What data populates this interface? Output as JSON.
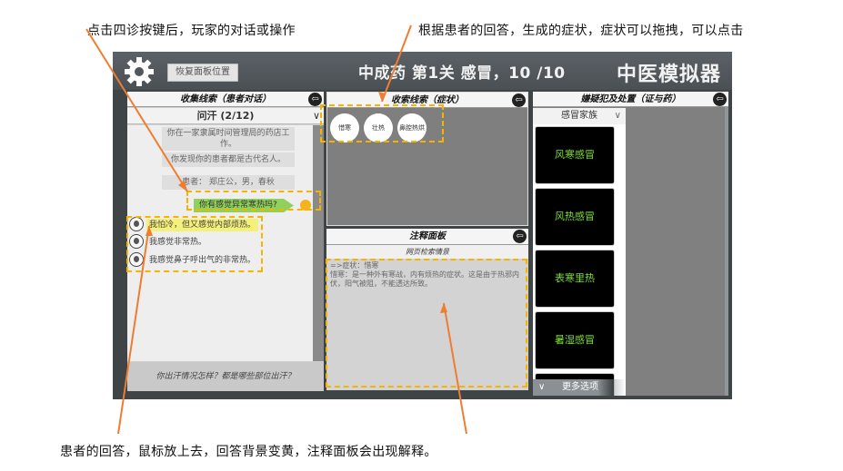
{
  "annotations": {
    "top_left": "点击四诊按键后，玩家的对话或操作",
    "top_right": "根据患者的回答，生成的症状，症状可以拖拽，可以点击",
    "bottom": "患者的回答，鼠标放上去，回答背景变黄，注释面板会出现解释。"
  },
  "header": {
    "settings_icon": "gear-icon",
    "restore_button": "恢复面板位置",
    "level_title": "中成药 第1关 感冒，10 /10",
    "app_title": "中医模拟器"
  },
  "clue_panel": {
    "title": "收集线索（患者对话）",
    "back_icon": "back-arrow-icon",
    "dropdown_value": "问汗 (2/12)",
    "system_messages": [
      "你在一家隶属时间管理局的药店工作。",
      "你发现你的患者都是古代名人。",
      "患者：  郑庄公，男，春秋"
    ],
    "player_message": "你有感觉异常寒热吗?",
    "patient_replies": [
      {
        "text": "我怕冷，但又感觉内部烦热。",
        "highlighted": true
      },
      {
        "text": "我感觉非常热。",
        "highlighted": false
      },
      {
        "text": "我感觉鼻子呼出气的非常热。",
        "highlighted": false
      }
    ],
    "question_prompt": "你出汗情况怎样？都是哪些部位出汗？"
  },
  "symptom_panel": {
    "title": "收索线索（症状）",
    "symptoms": [
      "惜寒",
      "壮热",
      "鼻腔热烘"
    ]
  },
  "note_panel": {
    "title": "注释面板",
    "subtitle": "网页检索情景",
    "line1": "=>症状：惜寒",
    "line2": "惜寒：是一种外有寒战，内有烦热的症状。这是由于热邪内伏，阳气被阻，不能透达所致。"
  },
  "diagnosis_panel": {
    "title": "嫌疑犯及处置（证与药）",
    "family_select": "感冒家族",
    "cards": [
      "风寒感冒",
      "风热感冒",
      "表寒里热",
      "暑湿感冒"
    ],
    "more_options": "更多选项"
  },
  "colors": {
    "highlight_dash": "#f4b400",
    "annotation_arrow": "#ee7d31",
    "card_text": "#7ee02c",
    "player_bubble": "#8fd15a"
  }
}
